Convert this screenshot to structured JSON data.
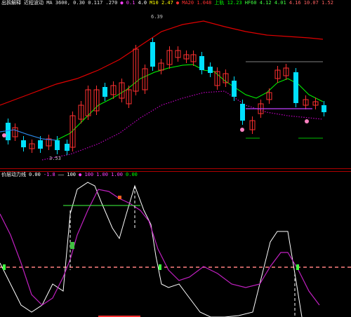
{
  "main_panel": {
    "legend": [
      {
        "text": "出拆解释",
        "color": "#ffffff"
      },
      {
        "text": "近程波动 MA 3600, 0.30 0.117 .270",
        "color": "#e8e8e8"
      },
      {
        "text": "● 0.1",
        "color": "#ff40ff"
      },
      {
        "text": "4.0",
        "color": "#ffffff"
      },
      {
        "text": "M10 2.47",
        "color": "#ffff00"
      },
      {
        "text": "● MA20 1.048",
        "color": "#ff3030"
      },
      {
        "text": "上轨 12.23",
        "color": "#00ff00"
      },
      {
        "text": "HF60 4.12 4.01",
        "color": "#40ff40"
      },
      {
        "text": "4.16 10.07 1.52",
        "color": "#ff6060"
      }
    ],
    "price_label": "6.39",
    "low_label": "3.53"
  },
  "sub_panel": {
    "legend": [
      {
        "text": "价层动力线",
        "color": "#ffffff"
      },
      {
        "text": "0.00",
        "color": "#ffffff"
      },
      {
        "text": "-1.8",
        "color": "#ff40ff"
      },
      {
        "text": "—— 100",
        "color": "#ffffff"
      },
      {
        "text": "● 100",
        "color": "#ff40ff"
      },
      {
        "text": "1.00 1.00",
        "color": "#ff40ff"
      },
      {
        "text": "0.00",
        "color": "#00ff00"
      }
    ]
  },
  "colors": {
    "up_candle": "#ff3030",
    "down_candle": "#00e0ff",
    "upper_band": "#e00000",
    "lower_band": "#c000c0",
    "ma_line": "#00ff00",
    "signal_line": "#ffffff",
    "k_line": "#c020c0",
    "ref_line": "#ff8080"
  }
}
